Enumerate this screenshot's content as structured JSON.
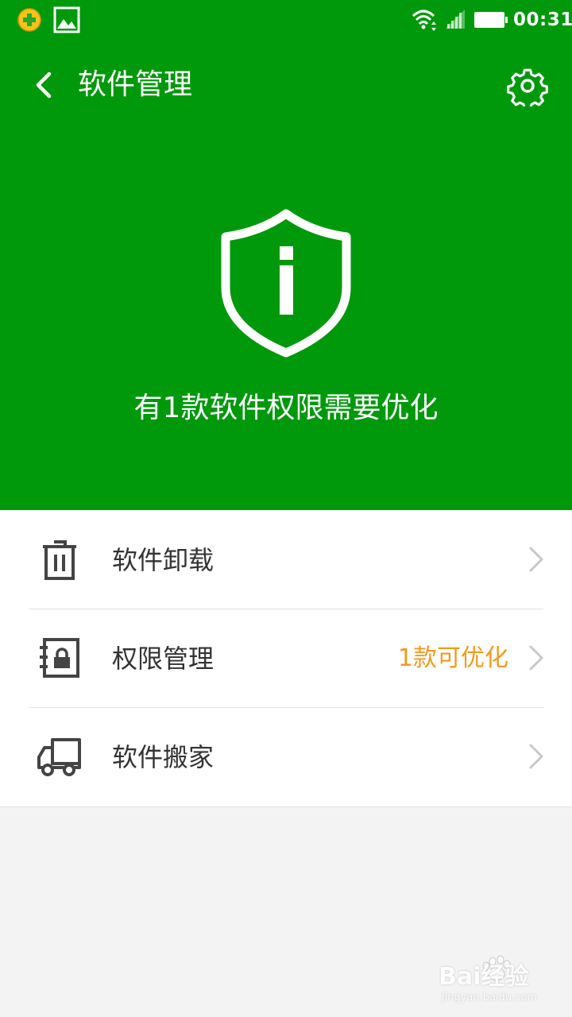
{
  "status_bar": {
    "time": "00:31",
    "icons": [
      "360-security-icon",
      "gallery-icon",
      "wifi-icon",
      "signal-icon",
      "battery-icon"
    ]
  },
  "header": {
    "title": "软件管理",
    "back_icon": "chevron-left-icon",
    "settings_icon": "gear-icon",
    "status_icon": "shield-info-icon",
    "status_text": "有1款软件权限需要优化",
    "background_color": "#00990b"
  },
  "menu": {
    "items": [
      {
        "label": "软件卸载",
        "icon": "trash-icon",
        "badge": ""
      },
      {
        "label": "权限管理",
        "icon": "lock-notebook-icon",
        "badge": "1款可优化"
      },
      {
        "label": "软件搬家",
        "icon": "truck-icon",
        "badge": ""
      }
    ],
    "badge_color": "#f39a1e"
  },
  "watermark": {
    "text": "Bai经验",
    "sub": "jingyan.baidu.com"
  }
}
